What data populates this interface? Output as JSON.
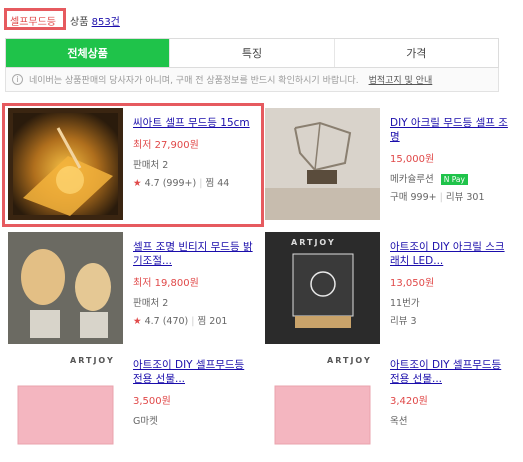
{
  "search": {
    "query": "셀프무드등",
    "result_label": "상품",
    "result_count": "853건"
  },
  "tabs": [
    {
      "label": "전체상품"
    },
    {
      "label": "특징"
    },
    {
      "label": "가격"
    }
  ],
  "notice": {
    "text": "네이버는 상품판매의 당사자가 아니며, 구매 전 상품정보를 반드시 확인하시기 바랍니다.",
    "link": "법적고지 및 안내"
  },
  "products": [
    {
      "title": "씨아트 셀프 무드등 15cm",
      "price": "최저 27,900원",
      "seller": "판매처 2",
      "rating": "4.7",
      "reviews": "(999+)",
      "zzim": "찜 44"
    },
    {
      "title": "DIY 아크릴 무드등 셀프 조명",
      "price": "15,000원",
      "seller": "메카슐루션",
      "npay": "N Pay",
      "buy": "구매 999+",
      "review": "리뷰 301"
    },
    {
      "title": "셀프 조명 빈티지 무드등 밝기조절...",
      "price": "최저 19,800원",
      "seller": "판매처 2",
      "rating": "4.7",
      "reviews": "(470)",
      "zzim": "찜 201"
    },
    {
      "title": "아트조이 DIY 아크릴 스크래치 LED...",
      "price": "13,050원",
      "seller": "11번가",
      "review": "리뷰 3",
      "brand": "ARTJOY"
    },
    {
      "title": "아트조이 DIY 셀프무드등 전용 선물...",
      "price": "3,500원",
      "seller": "G마켓",
      "brand": "ARTJOY"
    },
    {
      "title": "아트조이 DIY 셀프무드등 전용 선물...",
      "price": "3,420원",
      "seller": "옥션",
      "brand": "ARTJOY"
    }
  ],
  "colors": {
    "accent": "#1fc34a",
    "highlight": "#e65a5f",
    "price": "#e04848",
    "link": "#1a0dab"
  }
}
